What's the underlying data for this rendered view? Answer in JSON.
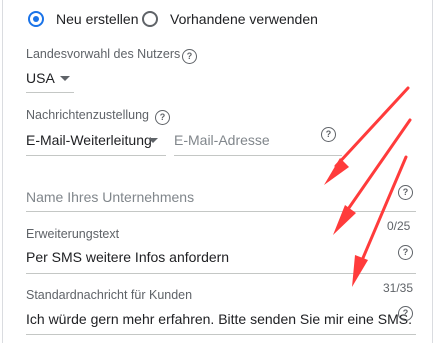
{
  "radio": {
    "option_new": "Neu erstellen",
    "option_existing": "Vorhandene verwenden"
  },
  "country": {
    "label": "Landesvorwahl des Nutzers",
    "value": "USA"
  },
  "delivery": {
    "label": "Nachrichtenzustellung",
    "value": "E-Mail-Weiterleitung",
    "email_placeholder": "E-Mail-Adresse"
  },
  "business_name": {
    "placeholder": "Name Ihres Unternehmens",
    "counter": "0/25"
  },
  "extension_text": {
    "label": "Erweiterungstext",
    "value": "Per SMS weitere Infos anfordern",
    "counter": "31/35"
  },
  "default_message": {
    "label": "Standardnachricht für Kunden",
    "value": "Ich würde gern mehr erfahren. Bitte senden Sie mir eine SMS."
  },
  "help_glyph": "?",
  "colors": {
    "accent": "#1a73e8",
    "annotation_arrow": "#ff3b3b"
  }
}
